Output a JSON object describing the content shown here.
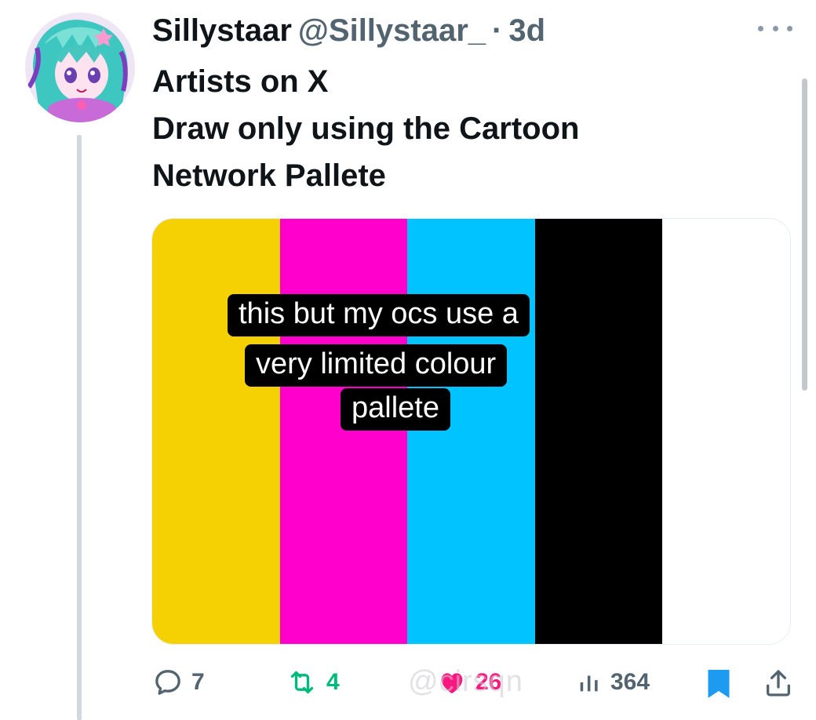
{
  "tweet": {
    "display_name": "Sillystaar",
    "handle": "@Sillystaar_",
    "separator": "·",
    "time": "3d",
    "text_lines": [
      "Artists on X",
      "Draw only using the Cartoon",
      "Network Pallete"
    ]
  },
  "media": {
    "caption_lines": [
      "this but my ocs use a",
      "very limited colour",
      "pallete"
    ],
    "palette_colors": [
      "#f5d003",
      "#ff00cc",
      "#00c3ff",
      "#000000",
      "#ffffff"
    ]
  },
  "actions": {
    "replies": "7",
    "reposts": "4",
    "likes": "26",
    "views": "364"
  },
  "overlay": {
    "watermark": "@cirsqn"
  },
  "colors": {
    "text_primary": "#0f1419",
    "text_secondary": "#536471",
    "repost_green": "#00ba7c",
    "like_pink": "#f91880",
    "bookmark_blue": "#1d9bf0"
  },
  "icons": [
    "more-icon",
    "reply-icon",
    "repost-icon",
    "like-icon",
    "views-icon",
    "bookmark-icon",
    "share-icon"
  ]
}
